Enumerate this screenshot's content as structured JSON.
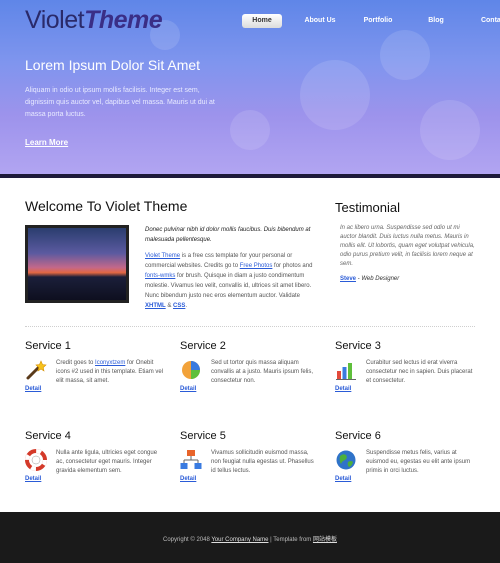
{
  "header": {
    "logo_light": "Violet",
    "logo_bold": "Theme",
    "nav": [
      {
        "label": "Home",
        "active": true
      },
      {
        "label": "About Us",
        "active": false
      },
      {
        "label": "Portfolio",
        "active": false
      },
      {
        "label": "Blog",
        "active": false
      },
      {
        "label": "Contact",
        "active": false
      }
    ]
  },
  "hero": {
    "title": "Lorem Ipsum Dolor Sit Amet",
    "text": "Aliquam in odio ut ipsum mollis facilisis. Integer est sem, dignissim quis auctor vel, dapibus vel massa. Mauris ut dui at massa porta luctus.",
    "link": "Learn More"
  },
  "welcome": {
    "title": "Welcome To Violet Theme",
    "intro": "Donec pulvinar nibh id dolor mollis faucibus. Duis bibendum at malesuada pellentesque.",
    "p1": "Violet Theme",
    "p2": " is a free css template for your personal or commercial websites. Credits go to ",
    "p3": "Free Photos",
    "p4": " for photos and ",
    "p5": "fonts-wmks",
    "p6": " for brush. Quisque in diam a justo condimentum molestie. Vivamus leo velit, convallis id, ultrices sit amet libero. Nunc bibendum justo nec eros elementum auctor. Validate ",
    "p7": "XHTML",
    "p8": " & ",
    "p9": "CSS",
    "p10": "."
  },
  "testimonial": {
    "title": "Testimonial",
    "quote": "In ac libero urna. Suspendisse sed odio ut mi auctor blandit. Duis luctus nulla metus. Mauris in mollis elit. Ut lobortis, quam eget volutpat vehicula, odio purus pretium velit, in facilisis lorem neque at sem.",
    "name": "Steve",
    "role": " - Web Designer"
  },
  "services": [
    {
      "title": "Service 1",
      "icon": "magic-wand-icon",
      "desc_a": "Credit goes to ",
      "desc_link": "Iconyxtzem",
      "desc_b": " for Onebit icons #2 used in this template. Etiam vel elit massa, sit amet.",
      "detail": "Detail"
    },
    {
      "title": "Service 2",
      "icon": "pie-chart-icon",
      "desc_a": "Sed ut tortor quis massa aliquam convallis at a justo. Mauris ipsum felis, consectetur non.",
      "desc_link": "",
      "desc_b": "",
      "detail": "Detail"
    },
    {
      "title": "Service 3",
      "icon": "bar-chart-icon",
      "desc_a": "Curabitur sed lectus id erat viverra consectetur nec in sapien. Duis placerat et consectetur.",
      "desc_link": "",
      "desc_b": "",
      "detail": "Detail"
    },
    {
      "title": "Service 4",
      "icon": "lifebuoy-icon",
      "desc_a": "Nulla ante ligula, ultricies eget congue ac, consectetur eget mauris. Integer gravida elementum sem.",
      "desc_link": "",
      "desc_b": "",
      "detail": "Detail"
    },
    {
      "title": "Service 5",
      "icon": "sitemap-icon",
      "desc_a": "Vivamus sollicitudin euismod massa, non feugiat nulla egestas ut. Phasellus id tellus lectus.",
      "desc_link": "",
      "desc_b": "",
      "detail": "Detail"
    },
    {
      "title": "Service 6",
      "icon": "globe-icon",
      "desc_a": "Suspendisse metus felis, varius at euismod eu, egestas eu elit ante ipsum primis in orci luctus.",
      "desc_link": "",
      "desc_b": "",
      "detail": "Detail"
    }
  ],
  "footer": {
    "copyright": "Copyright © 2048 ",
    "company": "Your Company Name",
    "sep": " | Template from ",
    "source": "网站模板"
  },
  "colors": {
    "accent": "#2a5bd7",
    "hero_top": "#5f86e8",
    "hero_bottom": "#b3a6f2",
    "footer": "#1a1a1a"
  }
}
